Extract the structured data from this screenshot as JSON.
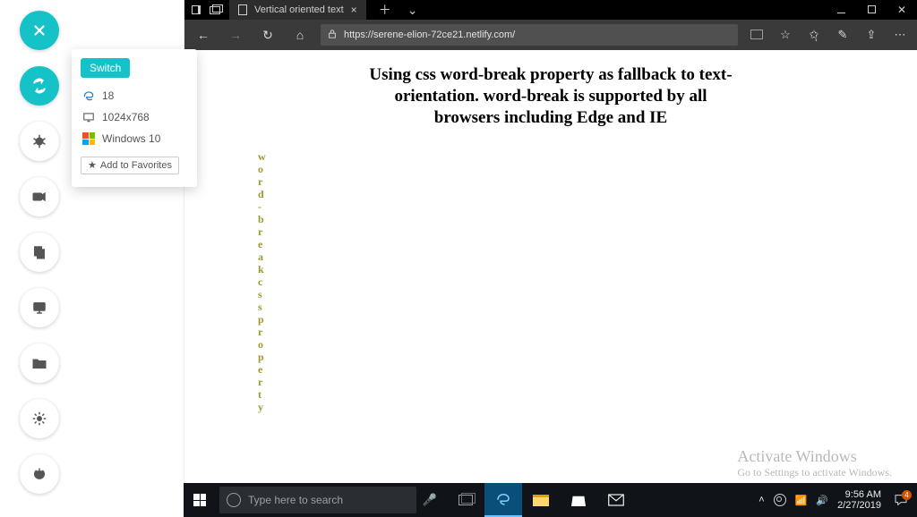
{
  "toolstrip": {
    "buttons": [
      "close",
      "sync",
      "bug",
      "video",
      "copy",
      "display-test",
      "folder",
      "settings",
      "power"
    ]
  },
  "panel": {
    "switch_label": "Switch",
    "browser_version": "18",
    "resolution": "1024x768",
    "os": "Windows 10",
    "favorites_label": "Add to Favorites"
  },
  "browser": {
    "tab_title": "Vertical oriented text",
    "url": "https://serene-elion-72ce21.netlify.com/"
  },
  "page_content": {
    "heading": "Using css word-break property as fallback to text-orientation. word-break is supported by all browsers including Edge and IE",
    "vertical_text": "word-break css property"
  },
  "watermark": {
    "line1": "Activate Windows",
    "line2": "Go to Settings to activate Windows."
  },
  "taskbar": {
    "search_placeholder": "Type here to search",
    "time": "9:56 AM",
    "date": "2/27/2019",
    "notif_count": "4"
  }
}
